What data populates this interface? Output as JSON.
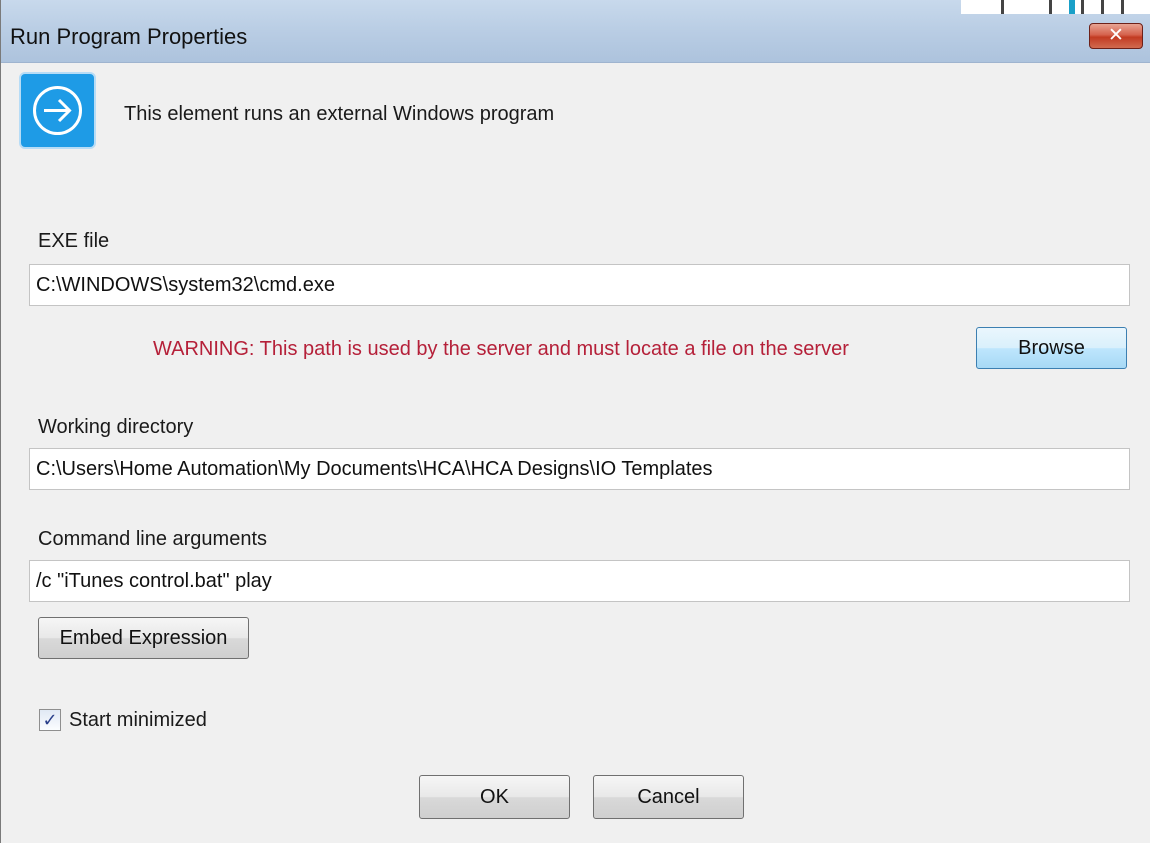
{
  "window": {
    "title": "Run Program Properties",
    "close_symbol": "✕"
  },
  "header": {
    "icon": "arrow-circle-right-icon",
    "description": "This element runs an external Windows program"
  },
  "exe": {
    "label": "EXE file",
    "value": "C:\\WINDOWS\\system32\\cmd.exe",
    "warning": "WARNING: This path is used by the server and must locate a file on the server",
    "browse_label": "Browse"
  },
  "working_dir": {
    "label": "Working directory",
    "value": "C:\\Users\\Home Automation\\My Documents\\HCA\\HCA Designs\\IO Templates"
  },
  "args": {
    "label": "Command line arguments",
    "value": "/c \"iTunes control.bat\" play",
    "embed_label": "Embed Expression"
  },
  "options": {
    "start_minimized_label": "Start minimized",
    "start_minimized_checked": true,
    "check_mark": "✓"
  },
  "footer": {
    "ok_label": "OK",
    "cancel_label": "Cancel"
  },
  "colors": {
    "warning": "#b52039",
    "icon_bg": "#1e9be6",
    "titlebar": "#b9cde4"
  }
}
